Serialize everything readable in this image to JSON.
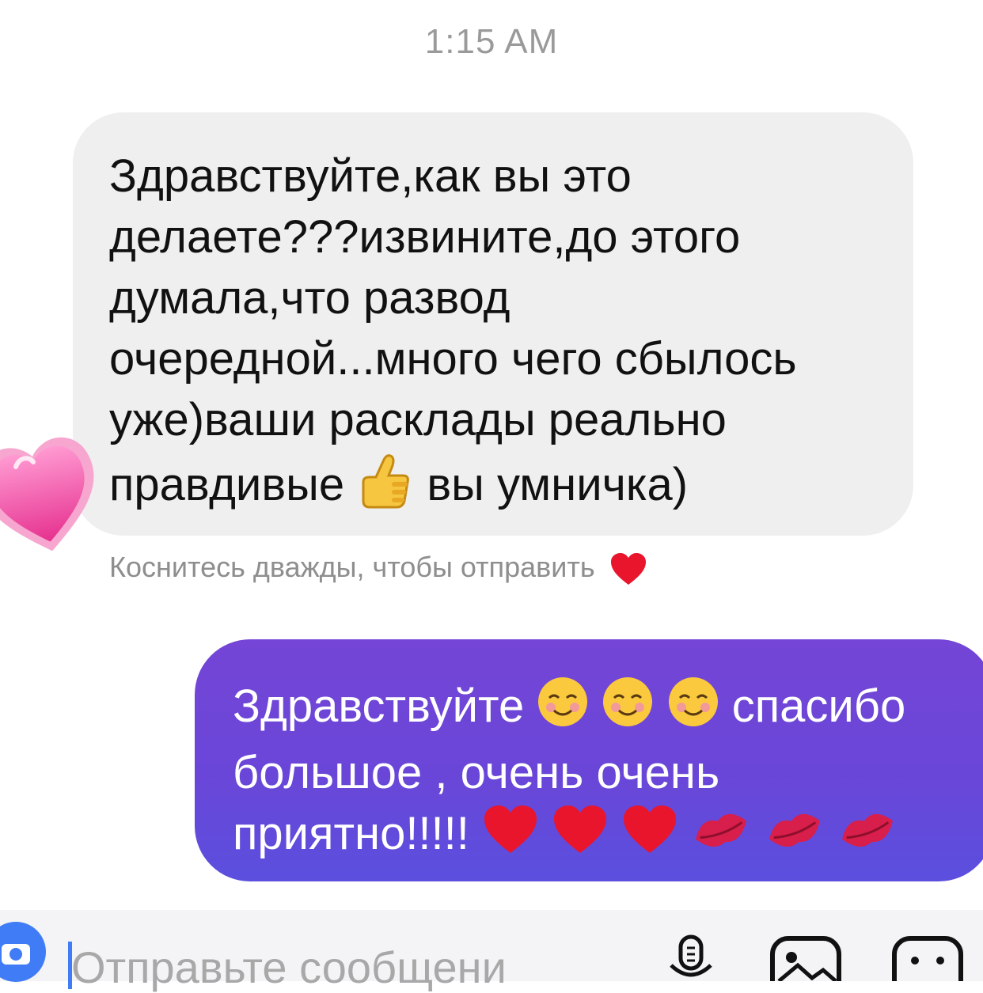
{
  "timestamp": "1:15 AM",
  "incoming": {
    "lines": [
      "Здравствуйте,как вы это",
      "делаете???извините,до этого",
      "думала,что развод",
      "очередной...много чего сбылось",
      "уже)ваши расклады реально"
    ],
    "last_line_before": "правдивые ",
    "last_line_emoji": "thumbs-up-icon",
    "last_line_after": "вы умничка)"
  },
  "reaction_hint": "Коснитесь дважды, чтобы отправить",
  "outgoing": {
    "line1_text": "Здравствуйте ",
    "line1_after": "спасибо",
    "line2": "большое , очень очень",
    "line3_text": "приятно!!!!! "
  },
  "composer": {
    "placeholder": "Отправьте сообщени"
  },
  "colors": {
    "outgoing_bubble": "#6a46d8",
    "incoming_bubble": "#efefef",
    "accent": "#3f7cf6"
  }
}
